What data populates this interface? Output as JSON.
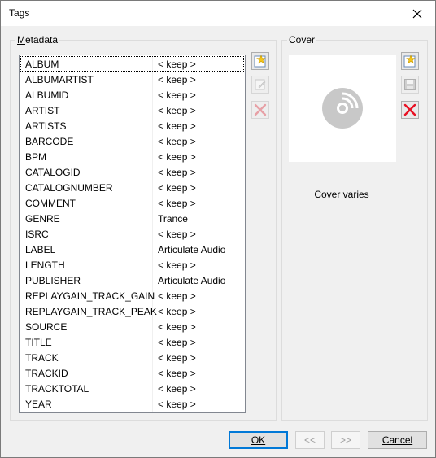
{
  "window": {
    "title": "Tags"
  },
  "metadata": {
    "label": "Metadata",
    "rows": [
      {
        "key": "ALBUM",
        "value": "< keep >",
        "selected": true
      },
      {
        "key": "ALBUMARTIST",
        "value": "< keep >"
      },
      {
        "key": "ALBUMID",
        "value": "< keep >"
      },
      {
        "key": "ARTIST",
        "value": "< keep >"
      },
      {
        "key": "ARTISTS",
        "value": "< keep >"
      },
      {
        "key": "BARCODE",
        "value": "< keep >"
      },
      {
        "key": "BPM",
        "value": "< keep >"
      },
      {
        "key": "CATALOGID",
        "value": "< keep >"
      },
      {
        "key": "CATALOGNUMBER",
        "value": "< keep >"
      },
      {
        "key": "COMMENT",
        "value": "< keep >"
      },
      {
        "key": "GENRE",
        "value": "Trance"
      },
      {
        "key": "ISRC",
        "value": "< keep >"
      },
      {
        "key": "LABEL",
        "value": "Articulate Audio"
      },
      {
        "key": "LENGTH",
        "value": "< keep >"
      },
      {
        "key": "PUBLISHER",
        "value": "Articulate Audio"
      },
      {
        "key": "REPLAYGAIN_TRACK_GAIN",
        "value": "< keep >"
      },
      {
        "key": "REPLAYGAIN_TRACK_PEAK",
        "value": "< keep >"
      },
      {
        "key": "SOURCE",
        "value": "< keep >"
      },
      {
        "key": "TITLE",
        "value": "< keep >"
      },
      {
        "key": "TRACK",
        "value": "< keep >"
      },
      {
        "key": "TRACKID",
        "value": "< keep >"
      },
      {
        "key": "TRACKTOTAL",
        "value": "< keep >"
      },
      {
        "key": "YEAR",
        "value": "< keep >"
      }
    ],
    "tools": [
      {
        "name": "add-tag-button",
        "icon": "new-star-icon",
        "enabled": true
      },
      {
        "name": "edit-tag-button",
        "icon": "edit-icon",
        "enabled": false
      },
      {
        "name": "remove-tag-button",
        "icon": "delete-x-icon",
        "enabled": false
      }
    ]
  },
  "cover": {
    "label": "Cover",
    "caption": "Cover varies",
    "tools": [
      {
        "name": "add-cover-button",
        "icon": "new-star-icon",
        "enabled": true
      },
      {
        "name": "save-cover-button",
        "icon": "save-icon",
        "enabled": false
      },
      {
        "name": "remove-cover-button",
        "icon": "delete-x-icon",
        "enabled": true
      }
    ]
  },
  "buttons": {
    "ok": "OK",
    "prev": "<<",
    "next": ">>",
    "cancel": "Cancel"
  },
  "colors": {
    "accent": "#0078d7",
    "delete": "#e81123",
    "star": "#f5c518",
    "disc": "#c8c8c8"
  }
}
